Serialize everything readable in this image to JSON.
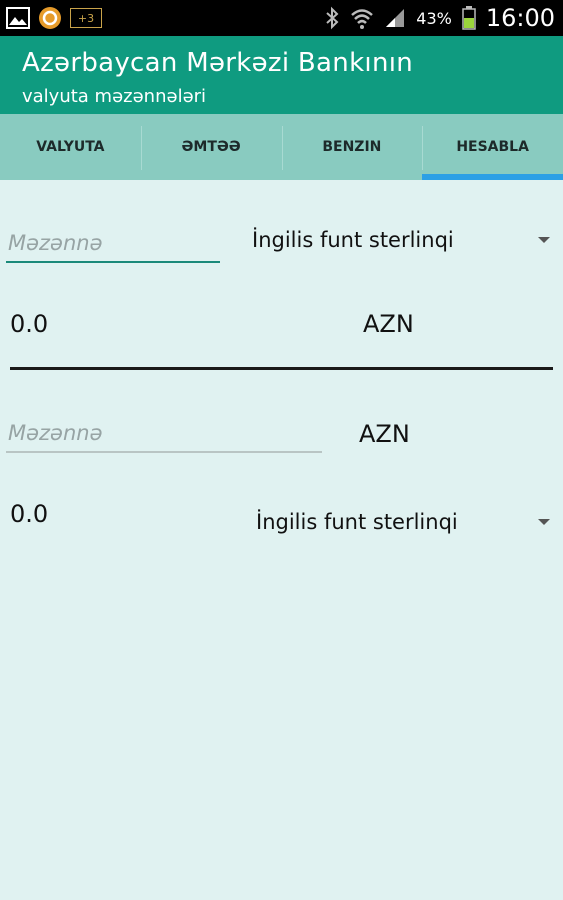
{
  "status_bar": {
    "battery_percent": "43%",
    "time": "16:00",
    "notification_badge": "+3"
  },
  "app": {
    "title": "Azərbaycan Mərkəzi Bankının",
    "subtitle": "valyuta məzənnələri"
  },
  "tabs": [
    {
      "label": "VALYUTA"
    },
    {
      "label": "ƏMTƏƏ"
    },
    {
      "label": "BENZIN"
    },
    {
      "label": "HESABLA"
    }
  ],
  "active_tab": "HESABLA",
  "converter_top": {
    "rate_input": {
      "placeholder": "Məzənnə",
      "value": ""
    },
    "currency_select": "İngilis funt sterlinqi",
    "result": "0.0",
    "result_currency": "AZN"
  },
  "converter_bottom": {
    "rate_input": {
      "placeholder": "Məzənnə",
      "value": ""
    },
    "input_currency": "AZN",
    "result": "0.0",
    "currency_select": "İngilis funt sterlinqi"
  },
  "colors": {
    "action_bar": "#0f9b80",
    "tab_bar": "#89cbc0",
    "tab_indicator": "#2ca0e5",
    "background": "#e0f2f1",
    "input_underline_active": "#1a8a7a"
  }
}
